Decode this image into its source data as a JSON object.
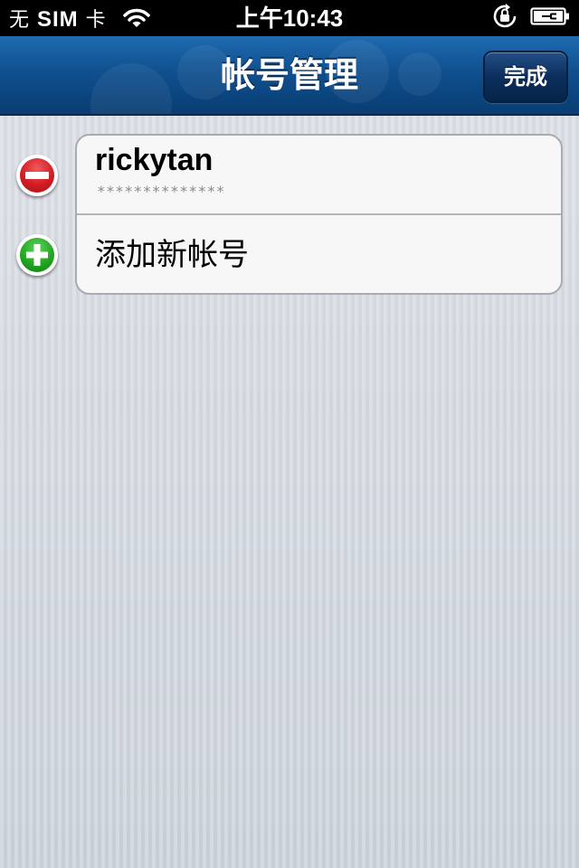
{
  "status_bar": {
    "carrier_prefix": "无 ",
    "carrier_sim": "SIM",
    "carrier_suffix": " 卡",
    "time": "上午10:43",
    "icons": [
      "wifi-icon",
      "rotation-lock-icon",
      "battery-charging-icon"
    ]
  },
  "nav": {
    "title": "帐号管理",
    "done_label": "完成",
    "accent_color": "#10508f"
  },
  "accounts": [
    {
      "username": "rickytan",
      "password_masked": "**************"
    }
  ],
  "add_account": {
    "label": "添加新帐号"
  },
  "controls": {
    "delete_icon": "minus-circle-icon",
    "add_icon": "plus-circle-icon",
    "delete_color": "#d21d24",
    "add_color": "#22a722"
  }
}
